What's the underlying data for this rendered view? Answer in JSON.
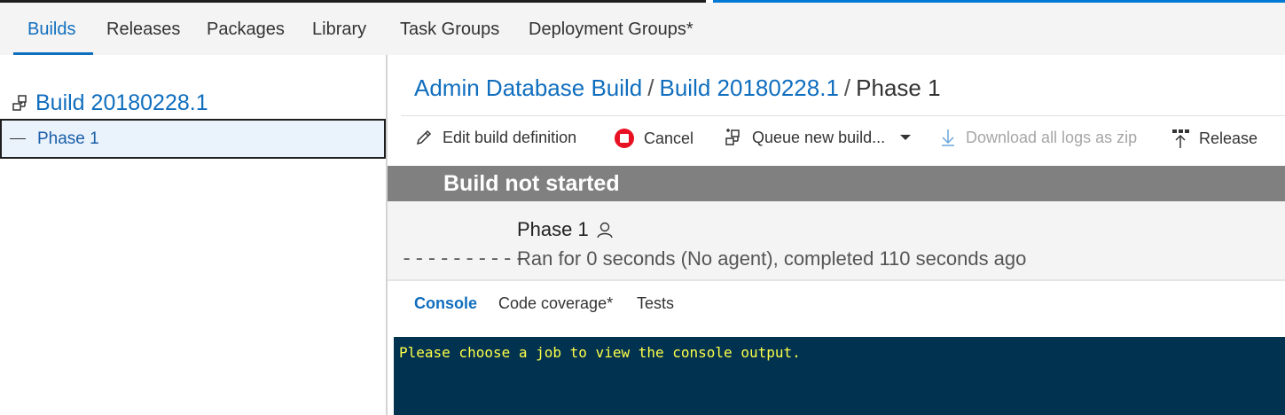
{
  "hub_tabs": [
    {
      "label": "Builds",
      "active": true
    },
    {
      "label": "Releases"
    },
    {
      "label": "Packages"
    },
    {
      "label": "Library"
    },
    {
      "label": "Task Groups"
    },
    {
      "label": "Deployment Groups*"
    }
  ],
  "tree": {
    "build_label": "Build 20180228.1",
    "build_icon": "build-definition-icon",
    "phase_label": "Phase 1"
  },
  "breadcrumb": {
    "definition": "Admin Database Build",
    "build": "Build 20180228.1",
    "current": "Phase 1",
    "separator": "/"
  },
  "toolbar": {
    "edit": "Edit build definition",
    "cancel": "Cancel",
    "queue": "Queue new build...",
    "download": "Download all logs as zip",
    "release": "Release"
  },
  "banner": {
    "title": "Build not started",
    "color": "#808080"
  },
  "job": {
    "name": "Phase 1",
    "dashes": "----------",
    "status": "Ran for 0 seconds (No agent), completed 110 seconds ago"
  },
  "subtabs": [
    {
      "label": "Console",
      "active": true
    },
    {
      "label": "Code coverage*"
    },
    {
      "label": "Tests"
    }
  ],
  "console": {
    "message": "Please choose a job to view the console output.",
    "background": "#01324f",
    "text_color": "#ffff48"
  },
  "colors": {
    "accent": "#106ebe",
    "cancel_red": "#e81123"
  }
}
